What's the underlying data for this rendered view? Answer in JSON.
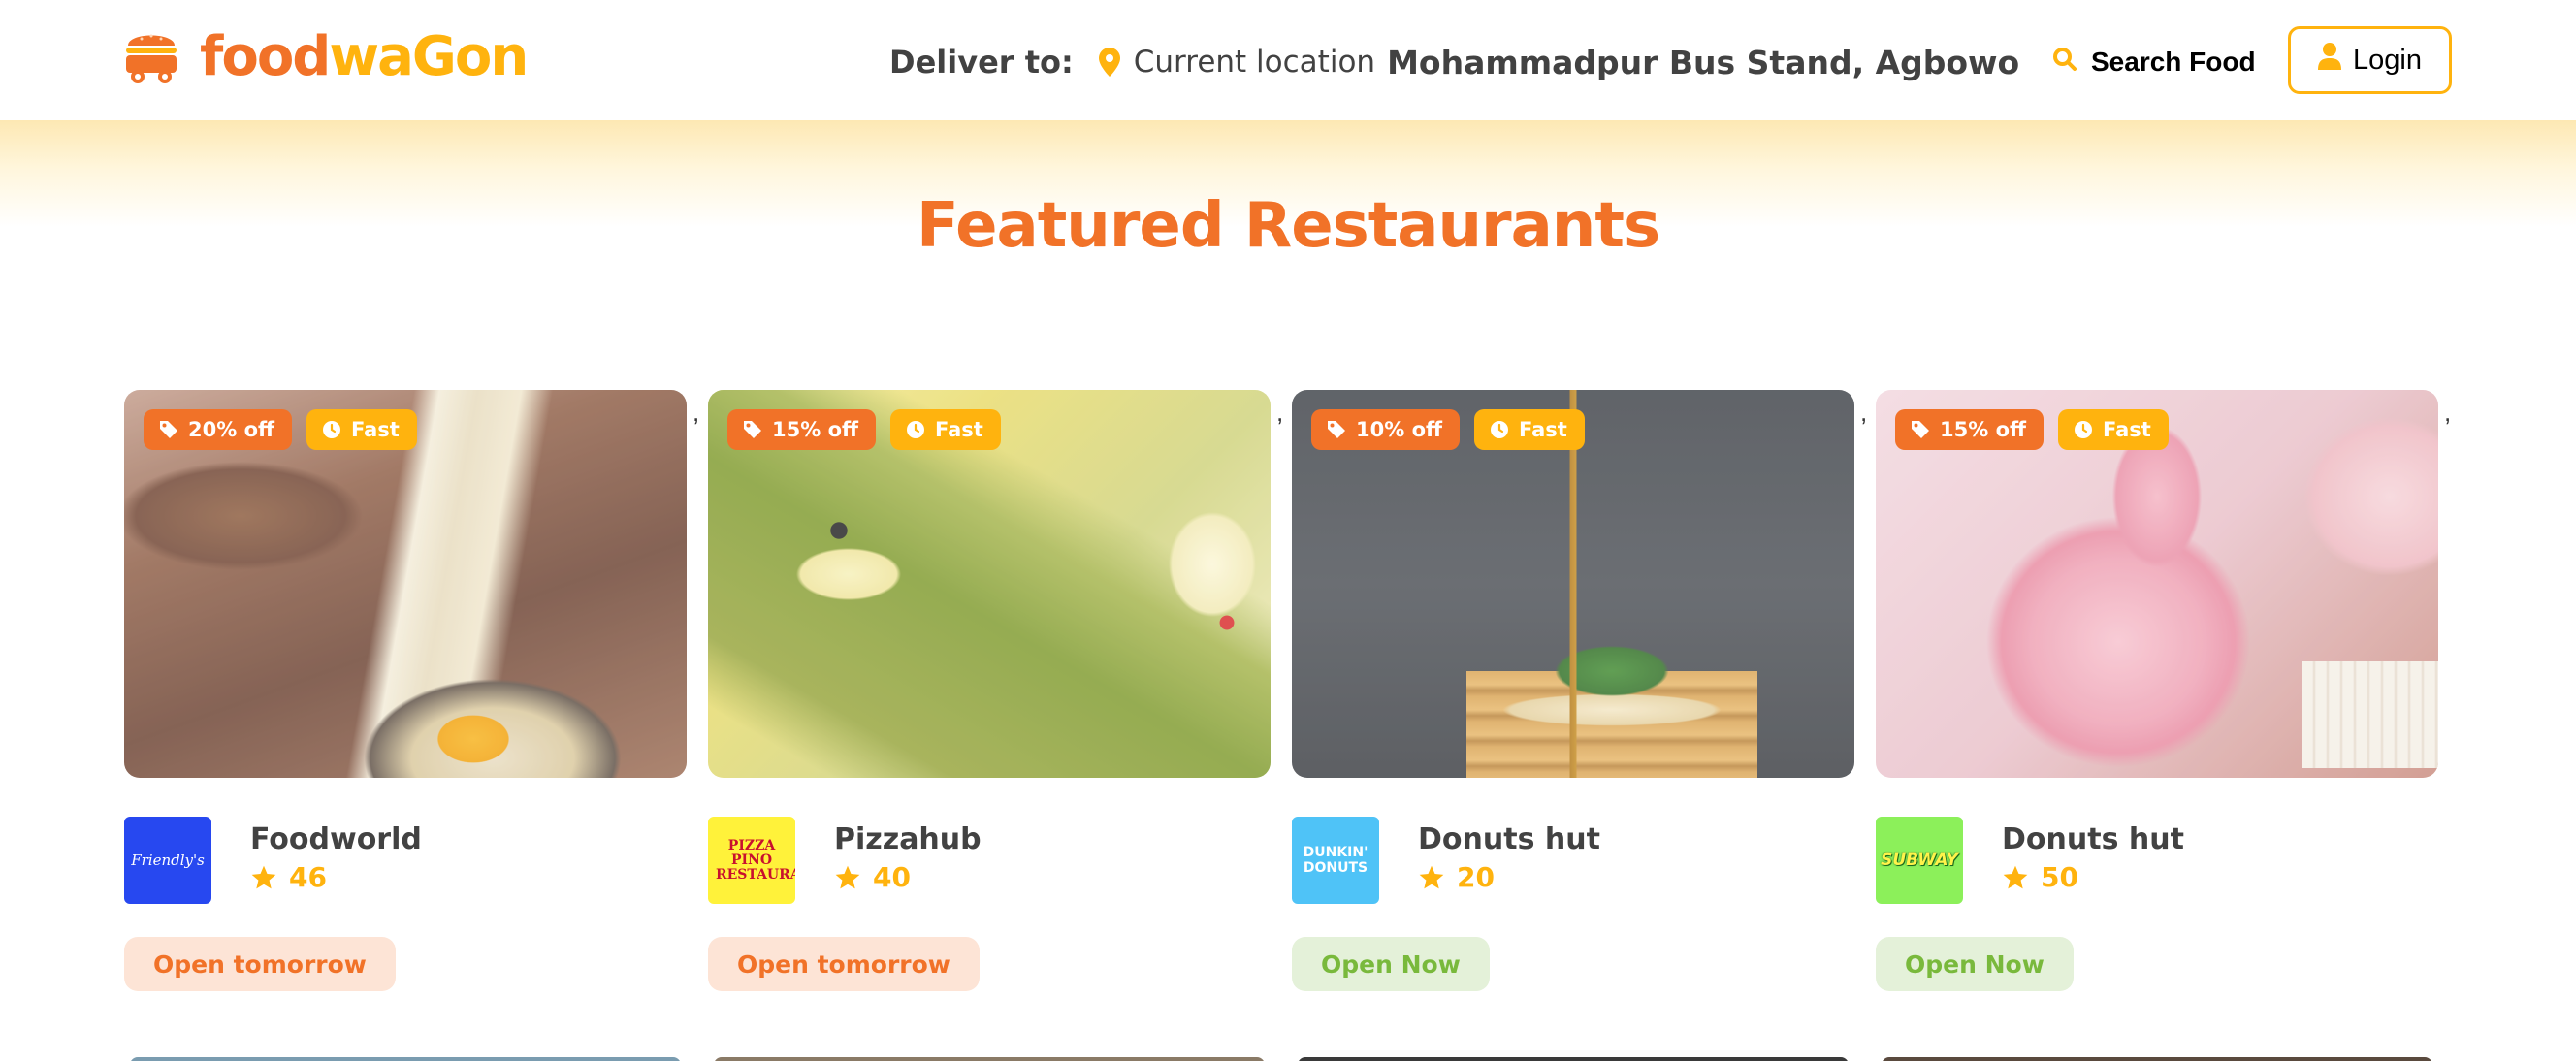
{
  "header": {
    "logo": {
      "part1": "food",
      "part2": "waGon"
    },
    "deliver_label": "Deliver to:",
    "current_location": "Current location",
    "address": "Mohammadpur Bus Stand, Agbowo",
    "search_label": "Search Food",
    "login_label": "Login"
  },
  "section": {
    "title": "Featured Restaurants"
  },
  "colors": {
    "primary_orange": "#f17228",
    "accent_yellow": "#ffb30e",
    "open_green": "#79b93c",
    "text_dark": "#424242"
  },
  "restaurants": [
    {
      "discount": "20% off",
      "speed": "Fast",
      "name": "Foodworld",
      "rating": "46",
      "status": "Open tomorrow",
      "brand_logo_text": "Friendly's",
      "brand_bg": "#2748f0"
    },
    {
      "discount": "15% off",
      "speed": "Fast",
      "name": "Pizzahub",
      "rating": "40",
      "status": "Open tomorrow",
      "brand_logo_text": "PIZZA PINO RESTAURANT",
      "brand_bg": "#fff23a"
    },
    {
      "discount": "10% off",
      "speed": "Fast",
      "name": "Donuts hut",
      "rating": "20",
      "status": "Open Now",
      "brand_logo_text": "DUNKIN' DONUTS",
      "brand_bg": "#4fc3f7"
    },
    {
      "discount": "15% off",
      "speed": "Fast",
      "name": "Donuts hut",
      "rating": "50",
      "status": "Open Now",
      "brand_logo_text": "SUBWAY",
      "brand_bg": "#8cf05a"
    }
  ],
  "separator": ","
}
